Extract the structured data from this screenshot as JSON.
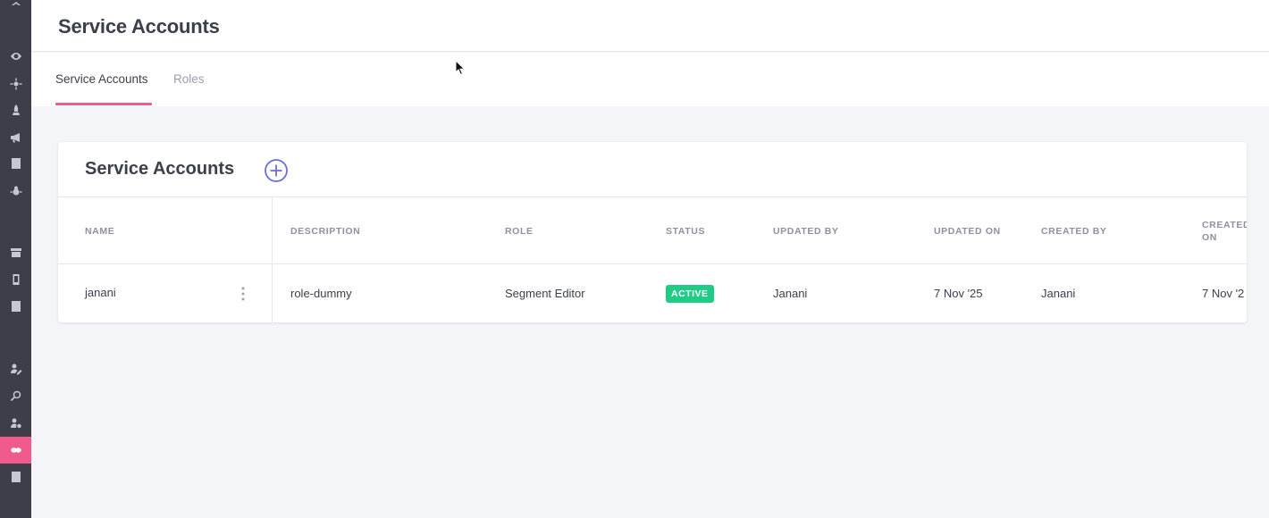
{
  "sidebar": {
    "icons": [
      {
        "name": "logo-icon"
      },
      {
        "name": "eye-icon"
      },
      {
        "name": "sparkle-icon"
      },
      {
        "name": "rocket-icon"
      },
      {
        "name": "megaphone-icon"
      },
      {
        "name": "report-icon"
      },
      {
        "name": "bug-icon"
      },
      {
        "name": "inbox-icon"
      },
      {
        "name": "mobile-icon"
      },
      {
        "name": "document-icon"
      },
      {
        "name": "user-edit-icon"
      },
      {
        "name": "user-search-icon"
      },
      {
        "name": "user-settings-icon"
      },
      {
        "name": "service-accounts-icon"
      },
      {
        "name": "billing-icon"
      }
    ],
    "active_color": "#f05a8c"
  },
  "header": {
    "title": "Service Accounts"
  },
  "tabs": [
    {
      "label": "Service Accounts",
      "active": true
    },
    {
      "label": "Roles",
      "active": false
    }
  ],
  "card": {
    "title": "Service Accounts",
    "add_icon": "plus-circle-icon",
    "columns": [
      "NAME",
      "DESCRIPTION",
      "ROLE",
      "STATUS",
      "UPDATED BY",
      "UPDATED ON",
      "CREATED BY",
      "CREATED ON"
    ],
    "rows": [
      {
        "name": "janani",
        "description": "role-dummy",
        "role": "Segment Editor",
        "status": "ACTIVE",
        "updated_by": "Janani",
        "updated_on": "7 Nov '25",
        "created_by": "Janani",
        "created_on": "7 Nov '2"
      }
    ]
  },
  "colors": {
    "accent": "#f05a8c",
    "status_active": "#1fcc86",
    "add_icon": "#6a6fd6",
    "sidebar_bg": "#3c3f48"
  }
}
